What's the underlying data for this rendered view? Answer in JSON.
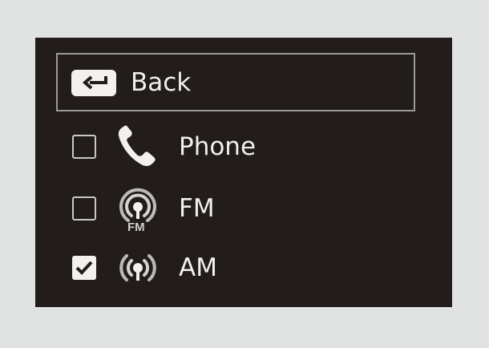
{
  "menu": {
    "back": {
      "label": "Back",
      "icon": "back-arrow-icon"
    },
    "items": [
      {
        "label": "Phone",
        "icon": "phone-icon",
        "checked": false
      },
      {
        "label": "FM",
        "icon": "fm-radio-icon",
        "icon_text": "FM",
        "checked": false
      },
      {
        "label": "AM",
        "icon": "am-radio-icon",
        "checked": true
      }
    ]
  },
  "colors": {
    "screen_bg": "#221c1b",
    "text": "#f1f0ef",
    "focus_border": "#9c9a98",
    "page_bg": "#e1e3e2"
  }
}
